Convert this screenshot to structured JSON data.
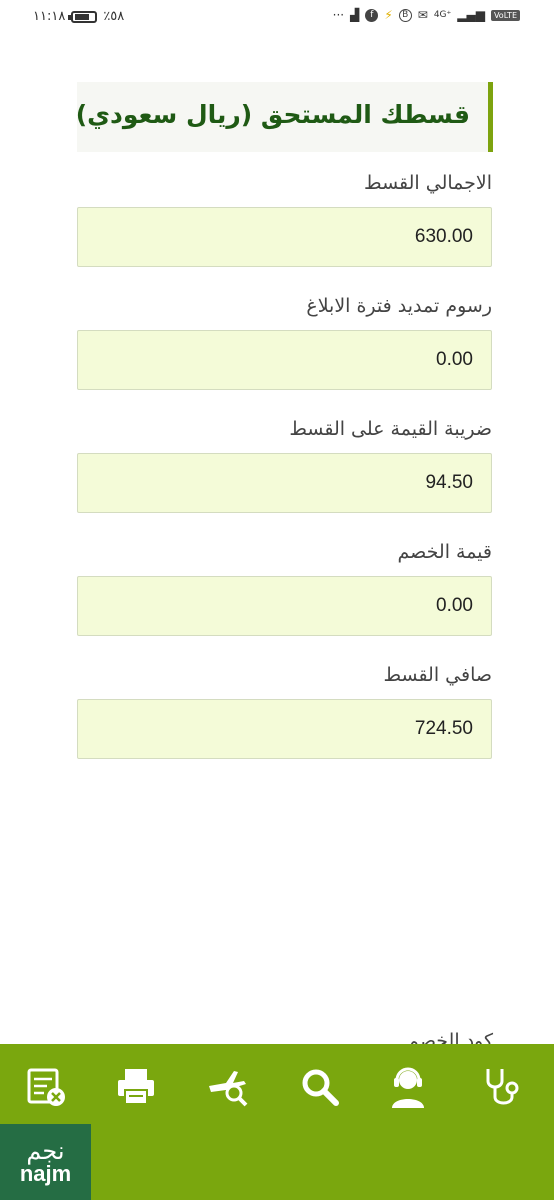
{
  "status_bar": {
    "time": "١١:١٨",
    "battery": "٪٥٨",
    "right_text": "4G⁺",
    "volte": "VoLTE",
    "more": "···"
  },
  "header": {
    "title": "قسطك المستحق (ريال سعودي)"
  },
  "fields": [
    {
      "label": "الاجمالي القسط",
      "value": "630.00"
    },
    {
      "label": "رسوم تمديد فترة الابلاغ",
      "value": "0.00"
    },
    {
      "label": "ضريبة القيمة على القسط",
      "value": "94.50"
    },
    {
      "label": "قيمة الخصم",
      "value": "0.00"
    },
    {
      "label": "صافي القسط",
      "value": "724.50"
    }
  ],
  "partial_label": "كود الخصم",
  "bottom_nav": {
    "icons": [
      "document-cancel-icon",
      "printer-icon",
      "flight-search-icon",
      "search-icon",
      "support-agent-icon",
      "stethoscope-icon"
    ]
  },
  "logo": {
    "arabic": "نجم",
    "english": "najm"
  },
  "colors": {
    "brand_green": "#7aa70e",
    "logo_green": "#256d44",
    "title_green": "#1f5a14",
    "field_bg": "#f4fbd8"
  }
}
